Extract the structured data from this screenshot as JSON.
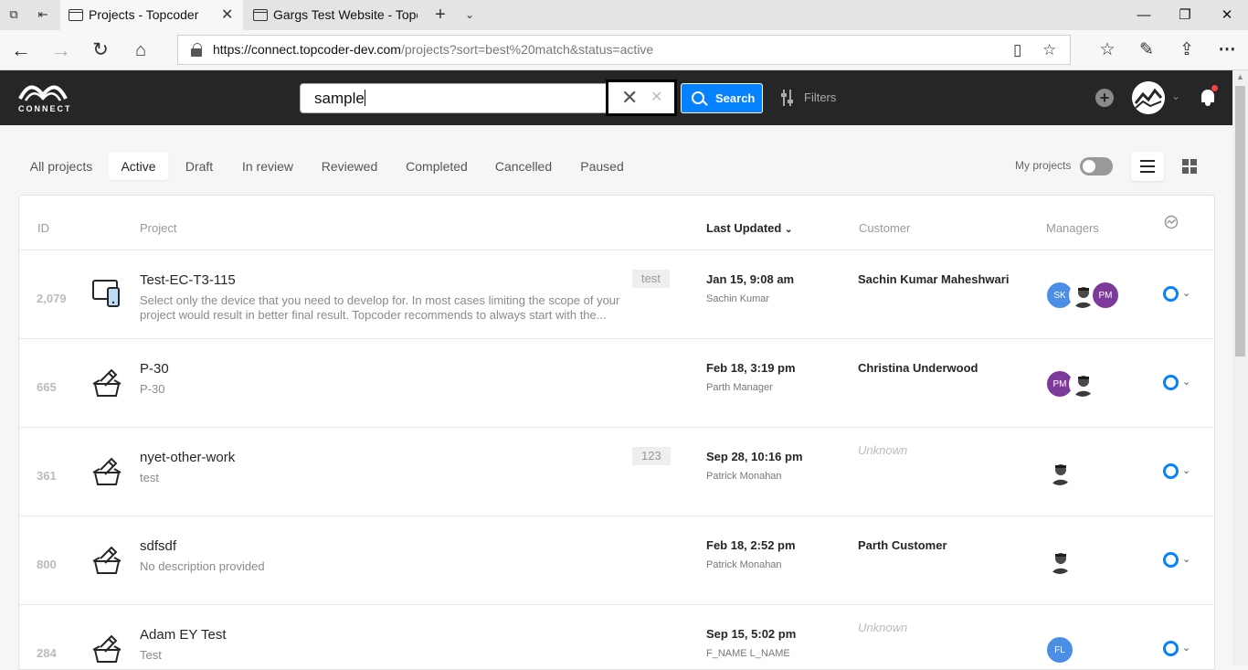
{
  "browser": {
    "tabs": [
      {
        "title": "Projects - Topcoder",
        "active": true
      },
      {
        "title": "Gargs Test Website - Topcoder",
        "active": false
      }
    ],
    "url_host": "https://connect.topcoder-dev.com",
    "url_path": "/projects?sort=best%20match&status=active"
  },
  "header": {
    "logo_text": "CONNECT",
    "search_value": "sample",
    "search_button": "Search",
    "filters_label": "Filters",
    "colors": {
      "bg": "#262626",
      "accent": "#0681ff",
      "notification": "#ff4040"
    }
  },
  "status_tabs": {
    "items": [
      "All projects",
      "Active",
      "Draft",
      "In review",
      "Reviewed",
      "Completed",
      "Cancelled",
      "Paused"
    ],
    "selected": "Active"
  },
  "my_projects_label": "My projects",
  "table": {
    "headers": {
      "id": "ID",
      "project": "Project",
      "last_updated": "Last Updated",
      "customer": "Customer",
      "managers": "Managers"
    },
    "rows": [
      {
        "id": "2,079",
        "icon": "device-icon",
        "name": "Test-EC-T3-115",
        "desc": "Select only the device that you need to develop for. In most cases limiting the scope of your project would result in better final result. Topcoder recommends to always start with the...",
        "tag": "test",
        "updated": "Jan 15, 9:08 am",
        "updated_by": "Sachin Kumar",
        "customer": "Sachin Kumar Maheshwari",
        "managers": [
          {
            "initials": "SK",
            "color": "#4a8ee6"
          },
          {
            "photo": true
          },
          {
            "initials": "PM",
            "color": "#7d3a9a"
          }
        ]
      },
      {
        "id": "665",
        "icon": "edit-box-icon",
        "name": "P-30",
        "desc": "P-30",
        "tag": "",
        "updated": "Feb 18, 3:19 pm",
        "updated_by": "Parth Manager",
        "customer": "Christina Underwood",
        "managers": [
          {
            "initials": "PM",
            "color": "#7d3a9a"
          },
          {
            "photo": true
          }
        ]
      },
      {
        "id": "361",
        "icon": "edit-box-icon",
        "name": "nyet-other-work",
        "desc": "test",
        "tag": "123",
        "updated": "Sep 28, 10:16 pm",
        "updated_by": "Patrick Monahan",
        "customer": "Unknown",
        "managers": [
          {
            "photo": true
          }
        ]
      },
      {
        "id": "800",
        "icon": "edit-box-icon",
        "name": "sdfsdf",
        "desc": "No description provided",
        "tag": "",
        "updated": "Feb 18, 2:52 pm",
        "updated_by": "Patrick Monahan",
        "customer": "Parth Customer",
        "managers": [
          {
            "photo": true
          }
        ]
      },
      {
        "id": "284",
        "icon": "edit-box-icon",
        "name": "Adam EY Test",
        "desc": "Test",
        "tag": "",
        "updated": "Sep 15, 5:02 pm",
        "updated_by": "F_NAME L_NAME",
        "customer": "Unknown",
        "managers": [
          {
            "initials": "FL",
            "color": "#4a8ee6"
          }
        ]
      }
    ]
  }
}
